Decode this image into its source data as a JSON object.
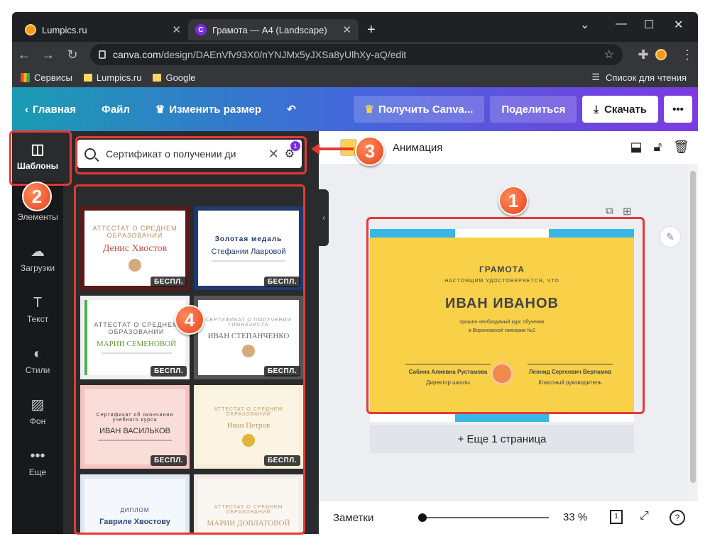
{
  "browser": {
    "tabs": [
      {
        "title": "Lumpics.ru"
      },
      {
        "title": "Грамота — A4 (Landscape)"
      }
    ],
    "url_host": "canva.com",
    "url_path": "/design/DAEnVfv93X0/nYNJMx5yJXSa8yUlhXy-aQ/edit",
    "bookmarks": [
      "Сервисы",
      "Lumpics.ru",
      "Google"
    ],
    "reading_list": "Список для чтения"
  },
  "topbar": {
    "home": "Главная",
    "file": "Файл",
    "resize": "Изменить размер",
    "get_pro": "Получить Canva...",
    "share": "Поделиться",
    "download": "Скачать"
  },
  "sidebar": {
    "items": [
      {
        "label": "Шаблоны",
        "icon": "layout-icon"
      },
      {
        "label": "Элементы",
        "icon": "shapes-icon"
      },
      {
        "label": "Загрузки",
        "icon": "upload-icon"
      },
      {
        "label": "Текст",
        "icon": "text-icon"
      },
      {
        "label": "Стили",
        "icon": "palette-icon"
      },
      {
        "label": "Фон",
        "icon": "background-icon"
      },
      {
        "label": "Еще",
        "icon": "more-icon"
      }
    ]
  },
  "search": {
    "value": "Сертификат о получении ди",
    "filter_count": "1"
  },
  "templates": {
    "free_label": "БЕСПЛ.",
    "items": [
      {
        "title": "АТТЕСТАТ О СРЕДНЕМ ОБРАЗОВАНИИ",
        "name": "Денис Хвостов"
      },
      {
        "title": "Золотая медаль",
        "name": "Стефании Лавровой"
      },
      {
        "title": "АТТЕСТАТ О СРЕДНЕМ ОБРАЗОВАНИИ",
        "name": "МАРИИ СЕМЕНОВОЙ"
      },
      {
        "title": "СЕРТИФИКАТ О ПОЛУЧЕНИИ ГИМНАЗИСТА",
        "name": "ИВАН СТЕПАНЧЕНКО"
      },
      {
        "title": "Сертификат об окончании учебного курса",
        "name": "ИВАН ВАСИЛЬКОВ"
      },
      {
        "title": "АТТЕСТАТ О СРЕДНЕМ ОБРАЗОВАНИИ",
        "name": "Иван Петров"
      },
      {
        "title": "ДИПЛОМ",
        "name": "Гавриле Хвостову"
      },
      {
        "title": "АТТЕСТАТ О СРЕДНЕМ ОБРАЗОВАНИИ",
        "name": "МАРИИ ДОВЛАТОВОЙ"
      }
    ]
  },
  "editor": {
    "animation": "Анимация",
    "add_page": "+ Еще 1 страница",
    "notes": "Заметки",
    "zoom": "33 %",
    "page_num": "1"
  },
  "design": {
    "title": "ГРАМОТА",
    "subtitle": "НАСТОЯЩИМ УДОСТОВЕРЯЕТСЯ, ЧТО",
    "name": "ИВАН ИВАНОВ",
    "line1": "прошел необходимый курс обучения",
    "line2": "в Воронежской гимназии №2",
    "sig_left_name": "Сабина Алиевна Рустамова",
    "sig_left_role": "Директор школы",
    "sig_right_name": "Леонид Сергеевич Верламов",
    "sig_right_role": "Классный руководитель"
  },
  "annotations": [
    "1",
    "2",
    "3",
    "4"
  ],
  "colors": {
    "accent_red": "#e53935",
    "canva_purple": "#7d2ae8",
    "design_yellow": "#f8d149",
    "design_blue": "#38b6e6"
  }
}
